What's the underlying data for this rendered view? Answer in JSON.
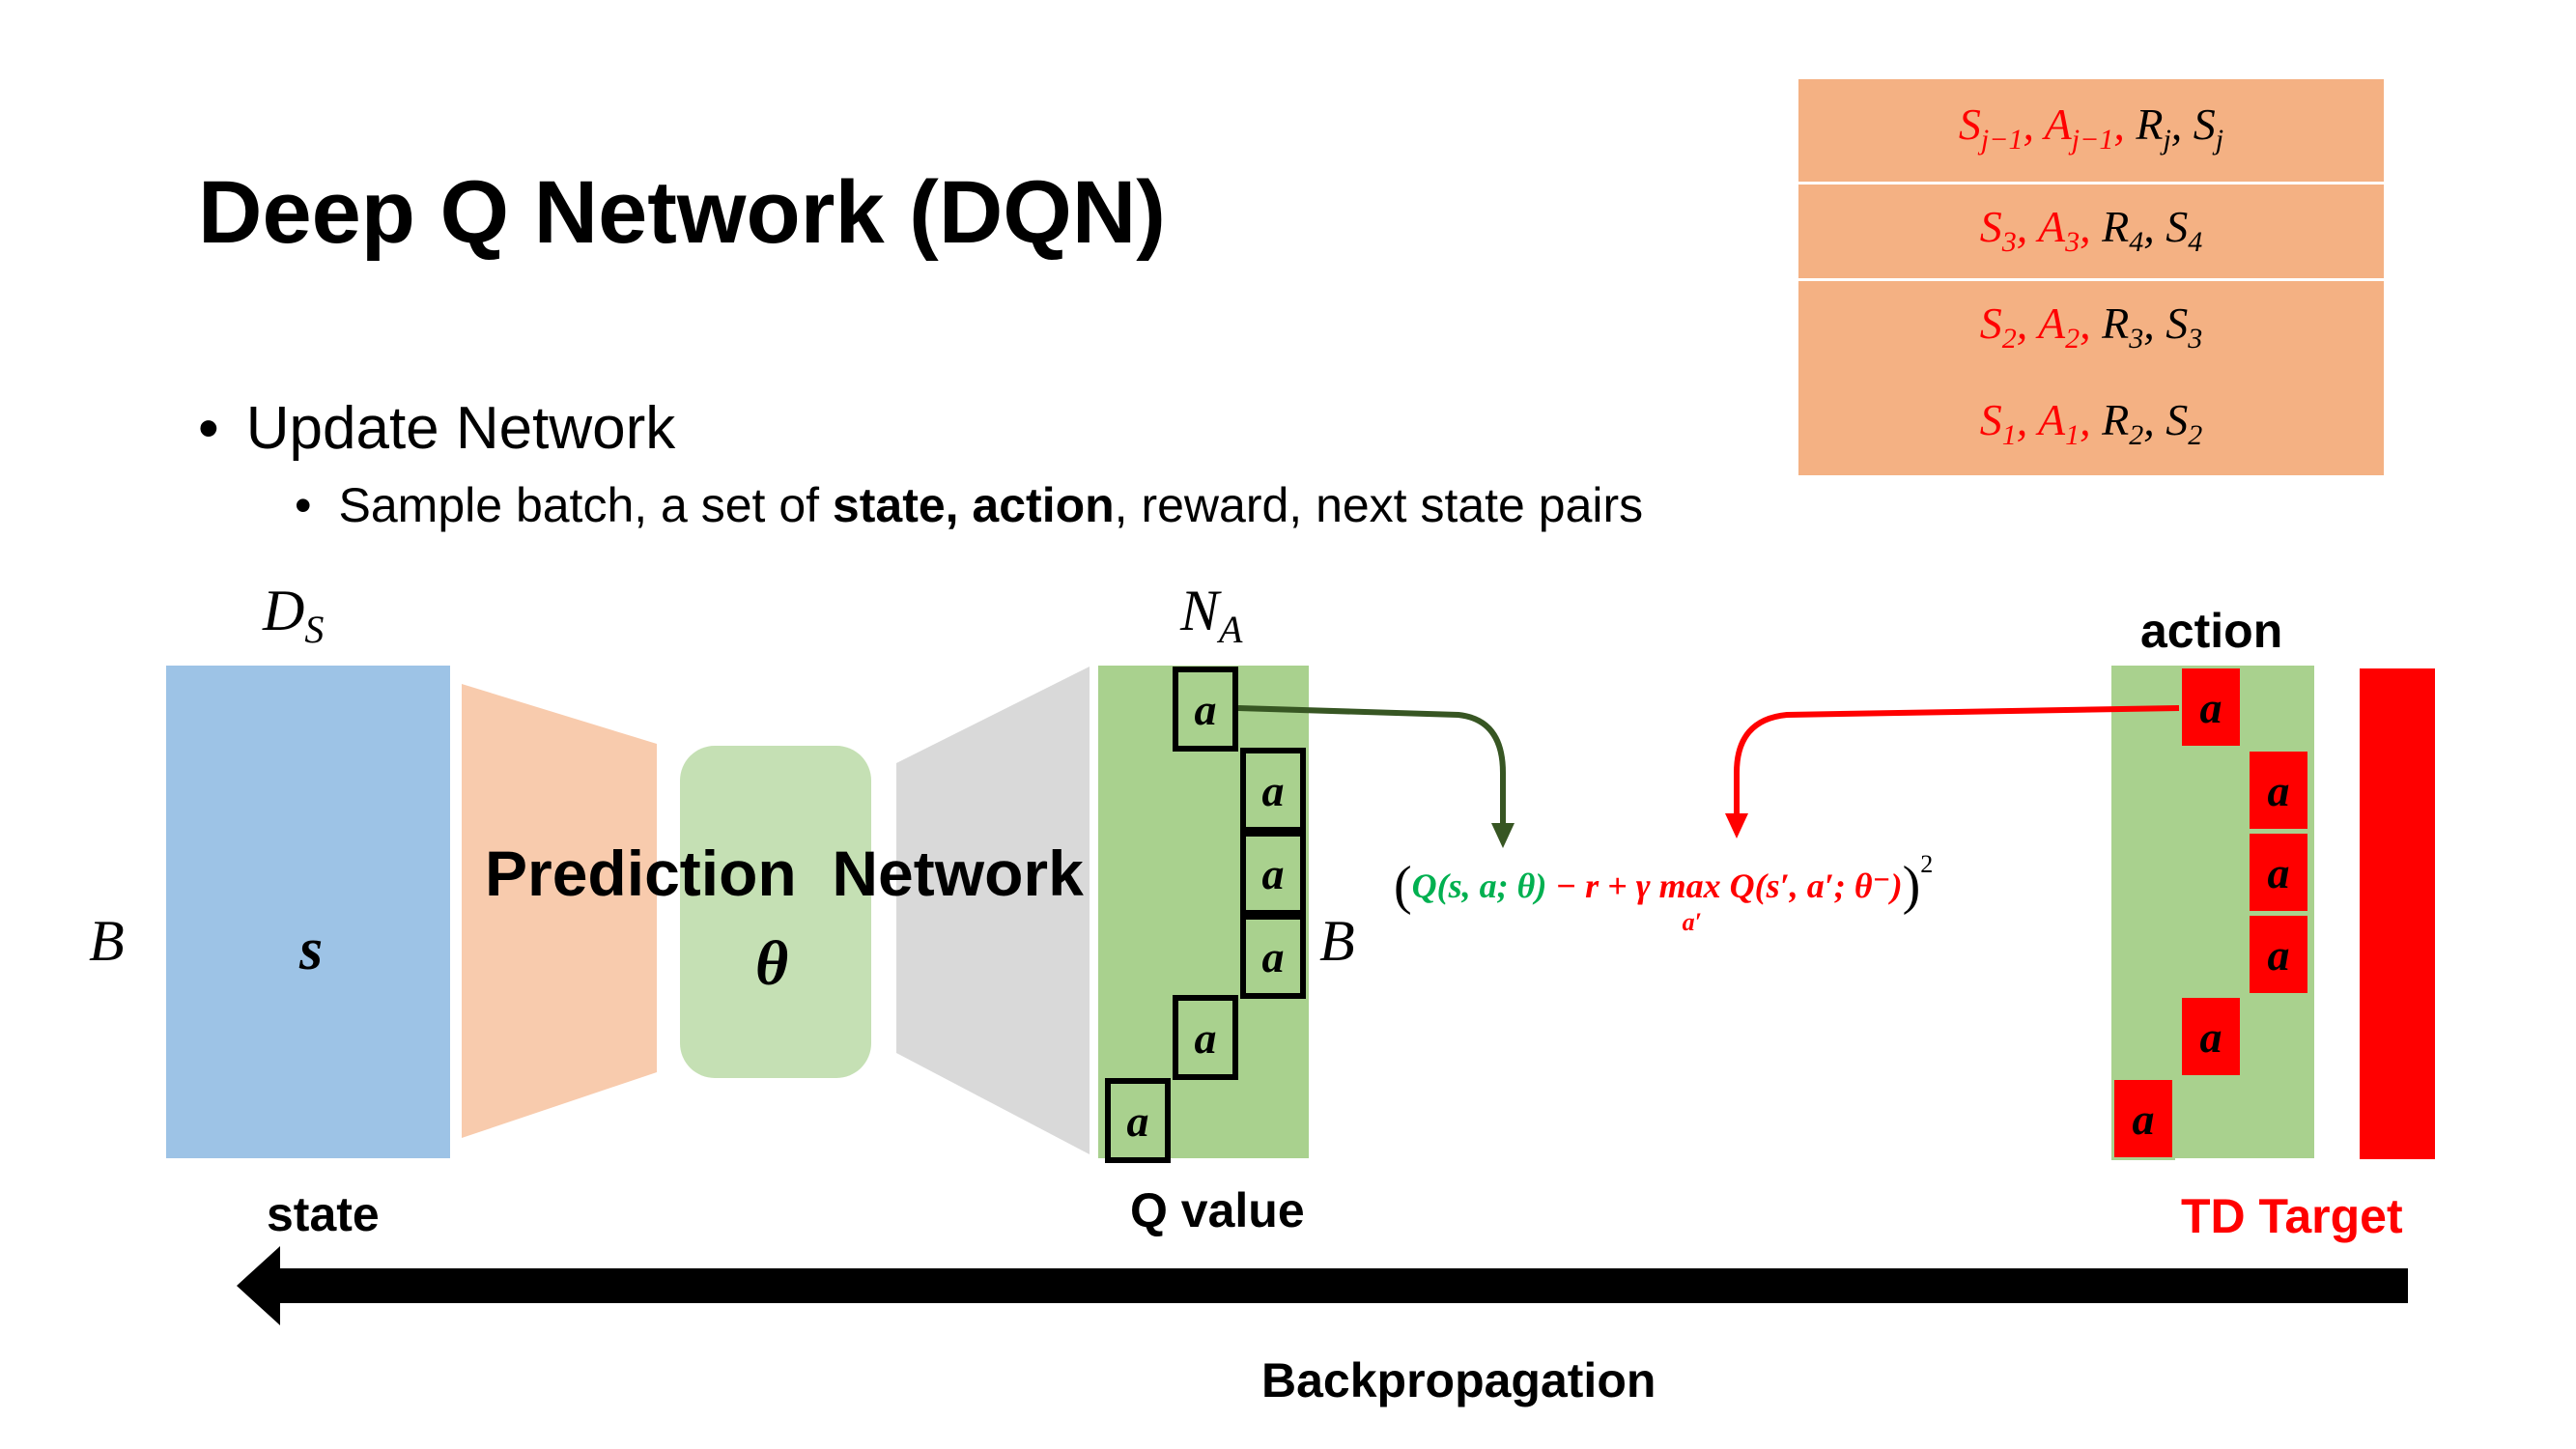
{
  "slide": {
    "title": "Deep Q Network (DQN)",
    "bullet_main": "Update Network",
    "bullet_sub": {
      "prefix": "Sample batch, a set of ",
      "bold": "state, action",
      "suffix": ", reward, next state pairs"
    }
  },
  "memory": {
    "rows": [
      {
        "red": "S",
        "red_sub": "j−1",
        "red2": "A",
        "red2_sub": "j−1",
        "k1": "R",
        "k1_sub": "j",
        "k2": "S",
        "k2_sub": "j"
      },
      {
        "red": "S",
        "red_sub": "3",
        "red2": "A",
        "red2_sub": "3",
        "k1": "R",
        "k1_sub": "4",
        "k2": "S",
        "k2_sub": "4"
      },
      {
        "red": "S",
        "red_sub": "2",
        "red2": "A",
        "red2_sub": "2",
        "k1": "R",
        "k1_sub": "3",
        "k2": "S",
        "k2_sub": "3"
      },
      {
        "red": "S",
        "red_sub": "1",
        "red2": "A",
        "red2_sub": "1",
        "k1": "R",
        "k1_sub": "2",
        "k2": "S",
        "k2_sub": "2"
      }
    ]
  },
  "network": {
    "ds_main": "D",
    "ds_sub": "S",
    "na_main": "N",
    "na_sub": "A",
    "b_left": "B",
    "b_right": "B",
    "state_symbol": "s",
    "prediction_label": "Prediction  Network",
    "theta": "θ",
    "cell_label": "a",
    "state_label": "state",
    "qvalue_label": "Q value",
    "action_label": "action",
    "td_label": "TD Target",
    "backprop_label": "Backpropagation"
  },
  "formula": {
    "open": "(",
    "green": "Q(s, a; θ)",
    "minus": " − ",
    "red_r": "r + γ ",
    "max": "max",
    "max_sub": "a′",
    "red_q": " Q(s′, a′; θ⁻)",
    "close": ")",
    "power": "2"
  },
  "colors": {
    "state": "#9DC3E6",
    "encoder": "#F8CBAD",
    "theta": "#C5E0B4",
    "decoder": "#D9D9D9",
    "qvalue": "#A9D18E",
    "memory": "#F4B183",
    "td_red": "#FF0000",
    "formula_green": "#00B050",
    "arrow_green": "#375623"
  }
}
